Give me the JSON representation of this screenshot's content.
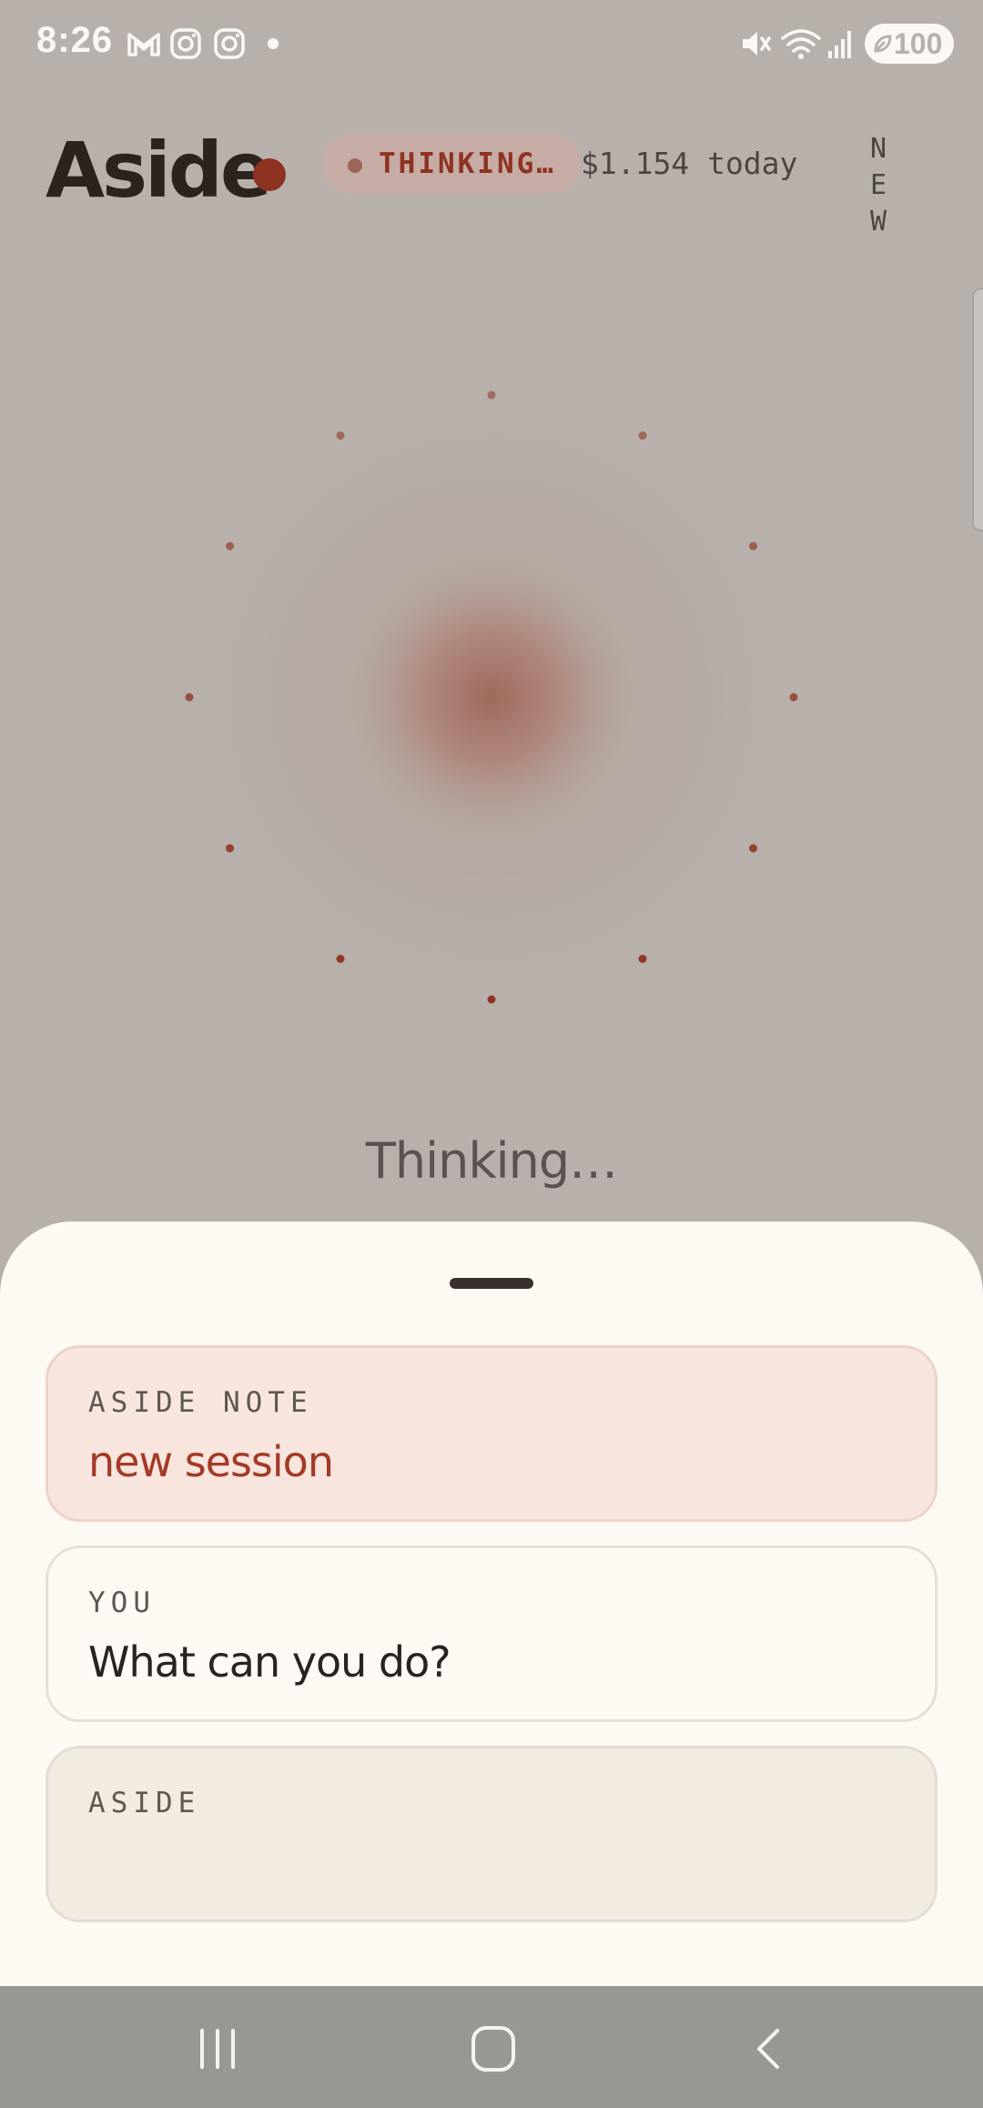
{
  "status_bar": {
    "time": "8:26",
    "notification_icons": [
      "gmail-icon",
      "instagram-icon",
      "instagram-icon",
      "more-dot-icon"
    ],
    "system_icons": [
      "mute-icon",
      "wifi-icon",
      "signal-icon"
    ],
    "battery": "100"
  },
  "header": {
    "title": "Aside",
    "status_chip": "THINKING…",
    "cost": "$1.154 today",
    "new_button": "NEW"
  },
  "orb": {
    "status_text": "Thinking…",
    "accent_color": "#8e3322"
  },
  "sheet": {
    "cards": [
      {
        "label": "ASIDE NOTE",
        "text": "new session"
      },
      {
        "label": "YOU",
        "text": "What can you do?"
      },
      {
        "label": "ASIDE",
        "text": ""
      }
    ]
  },
  "nav_bar": {
    "buttons": [
      "recent-apps-icon",
      "home-icon",
      "back-icon"
    ]
  },
  "colors": {
    "background": "#b8b1ab",
    "sheet": "#fdfaf4",
    "accent": "#8e3322",
    "note_card": "#f8e6de",
    "aside_card": "#f1ebe1"
  }
}
